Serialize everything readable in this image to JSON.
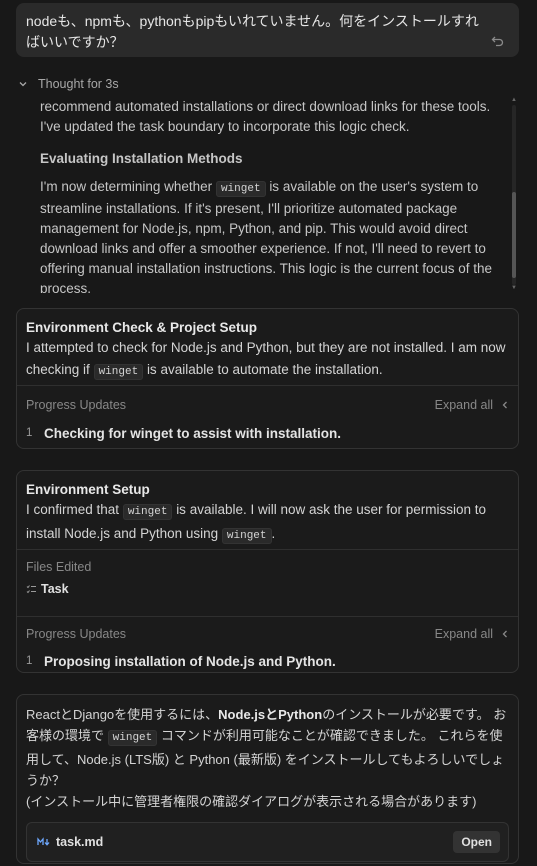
{
  "user_message": {
    "text": "nodeも、npmも、pythonもpipもいれていません。何をインストールすればいいですか？"
  },
  "thought": {
    "label": "Thought for 3s",
    "para1": "recommend automated installations or direct download links for these tools. I've updated the task boundary to incorporate this logic check.",
    "heading": "Evaluating Installation Methods",
    "para2_before": "I'm now determining whether",
    "para2_code": "winget",
    "para2_after": "is available on the user's system to streamline installations. If it's present, I'll prioritize automated package management for Node.js, npm, Python, and pip. This would avoid direct download links and offer a smoother experience. If not, I'll need to revert to offering manual installation instructions. This logic is the current focus of the process."
  },
  "card1": {
    "title": "Environment Check & Project Setup",
    "text_before": "I attempted to check for Node.js and Python, but they are not installed. I am now checking if",
    "text_code": "winget",
    "text_after": "is available to automate the installation.",
    "progress_label": "Progress Updates",
    "expand_label": "Expand all",
    "steps": [
      {
        "num": "1",
        "label": "Checking for winget to assist with installation."
      }
    ]
  },
  "card2": {
    "title": "Environment Setup",
    "text_before": "I confirmed that",
    "text_code": "winget",
    "text_mid": "is available. I will now ask the user for permission to install Node.js and Python using",
    "text_code2": "winget",
    "text_after": ".",
    "files_label": "Files Edited",
    "file_name": "Task",
    "progress_label": "Progress Updates",
    "expand_label": "Expand all",
    "steps": [
      {
        "num": "1",
        "label": "Proposing installation of Node.js and Python."
      }
    ]
  },
  "card3": {
    "line1_a": "ReactとDjangoを使用するには、",
    "line1_b": "Node.jsとPython",
    "line1_c": "のインストールが必要です。 お客様の環境で",
    "code": "winget",
    "line1_d": "コマンドが利用可能なことが確認できました。 これらを使用して、Node.js (LTS版) と Python (最新版) をインストールしてもよろしいでしょうか？",
    "line2": "(インストール中に管理者権限の確認ダイアログが表示される場合があります)",
    "file_name": "task.md",
    "open_label": "Open"
  },
  "colors": {
    "background": "#181818",
    "card_border": "#333333",
    "text": "#d4d4d4"
  }
}
